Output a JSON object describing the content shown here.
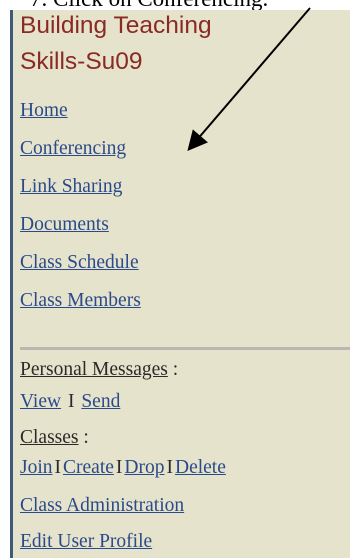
{
  "instruction": "7. Click on Conferencing.",
  "sidebar": {
    "title_line1": "Building Teaching",
    "title_line2": "Skills-Su09",
    "nav": [
      {
        "label": "Home"
      },
      {
        "label": "Conferencing"
      },
      {
        "label": "Link Sharing"
      },
      {
        "label": "Documents"
      },
      {
        "label": "Class Schedule"
      },
      {
        "label": "Class Members"
      }
    ],
    "personal_messages": {
      "label": "Personal Messages",
      "colon": " :",
      "view": "View",
      "sep": "I",
      "send": "Send"
    },
    "classes": {
      "label": "Classes",
      "colon": " :",
      "join": "Join",
      "create": "Create",
      "drop": "Drop",
      "delete": "Delete",
      "sep": "I"
    },
    "class_administration": "Class Administration",
    "edit_user_profile": "Edit User Profile"
  },
  "colors": {
    "panel_bg": "#e6e3cc",
    "title": "#8a2a24",
    "link": "#2a4a8a"
  }
}
